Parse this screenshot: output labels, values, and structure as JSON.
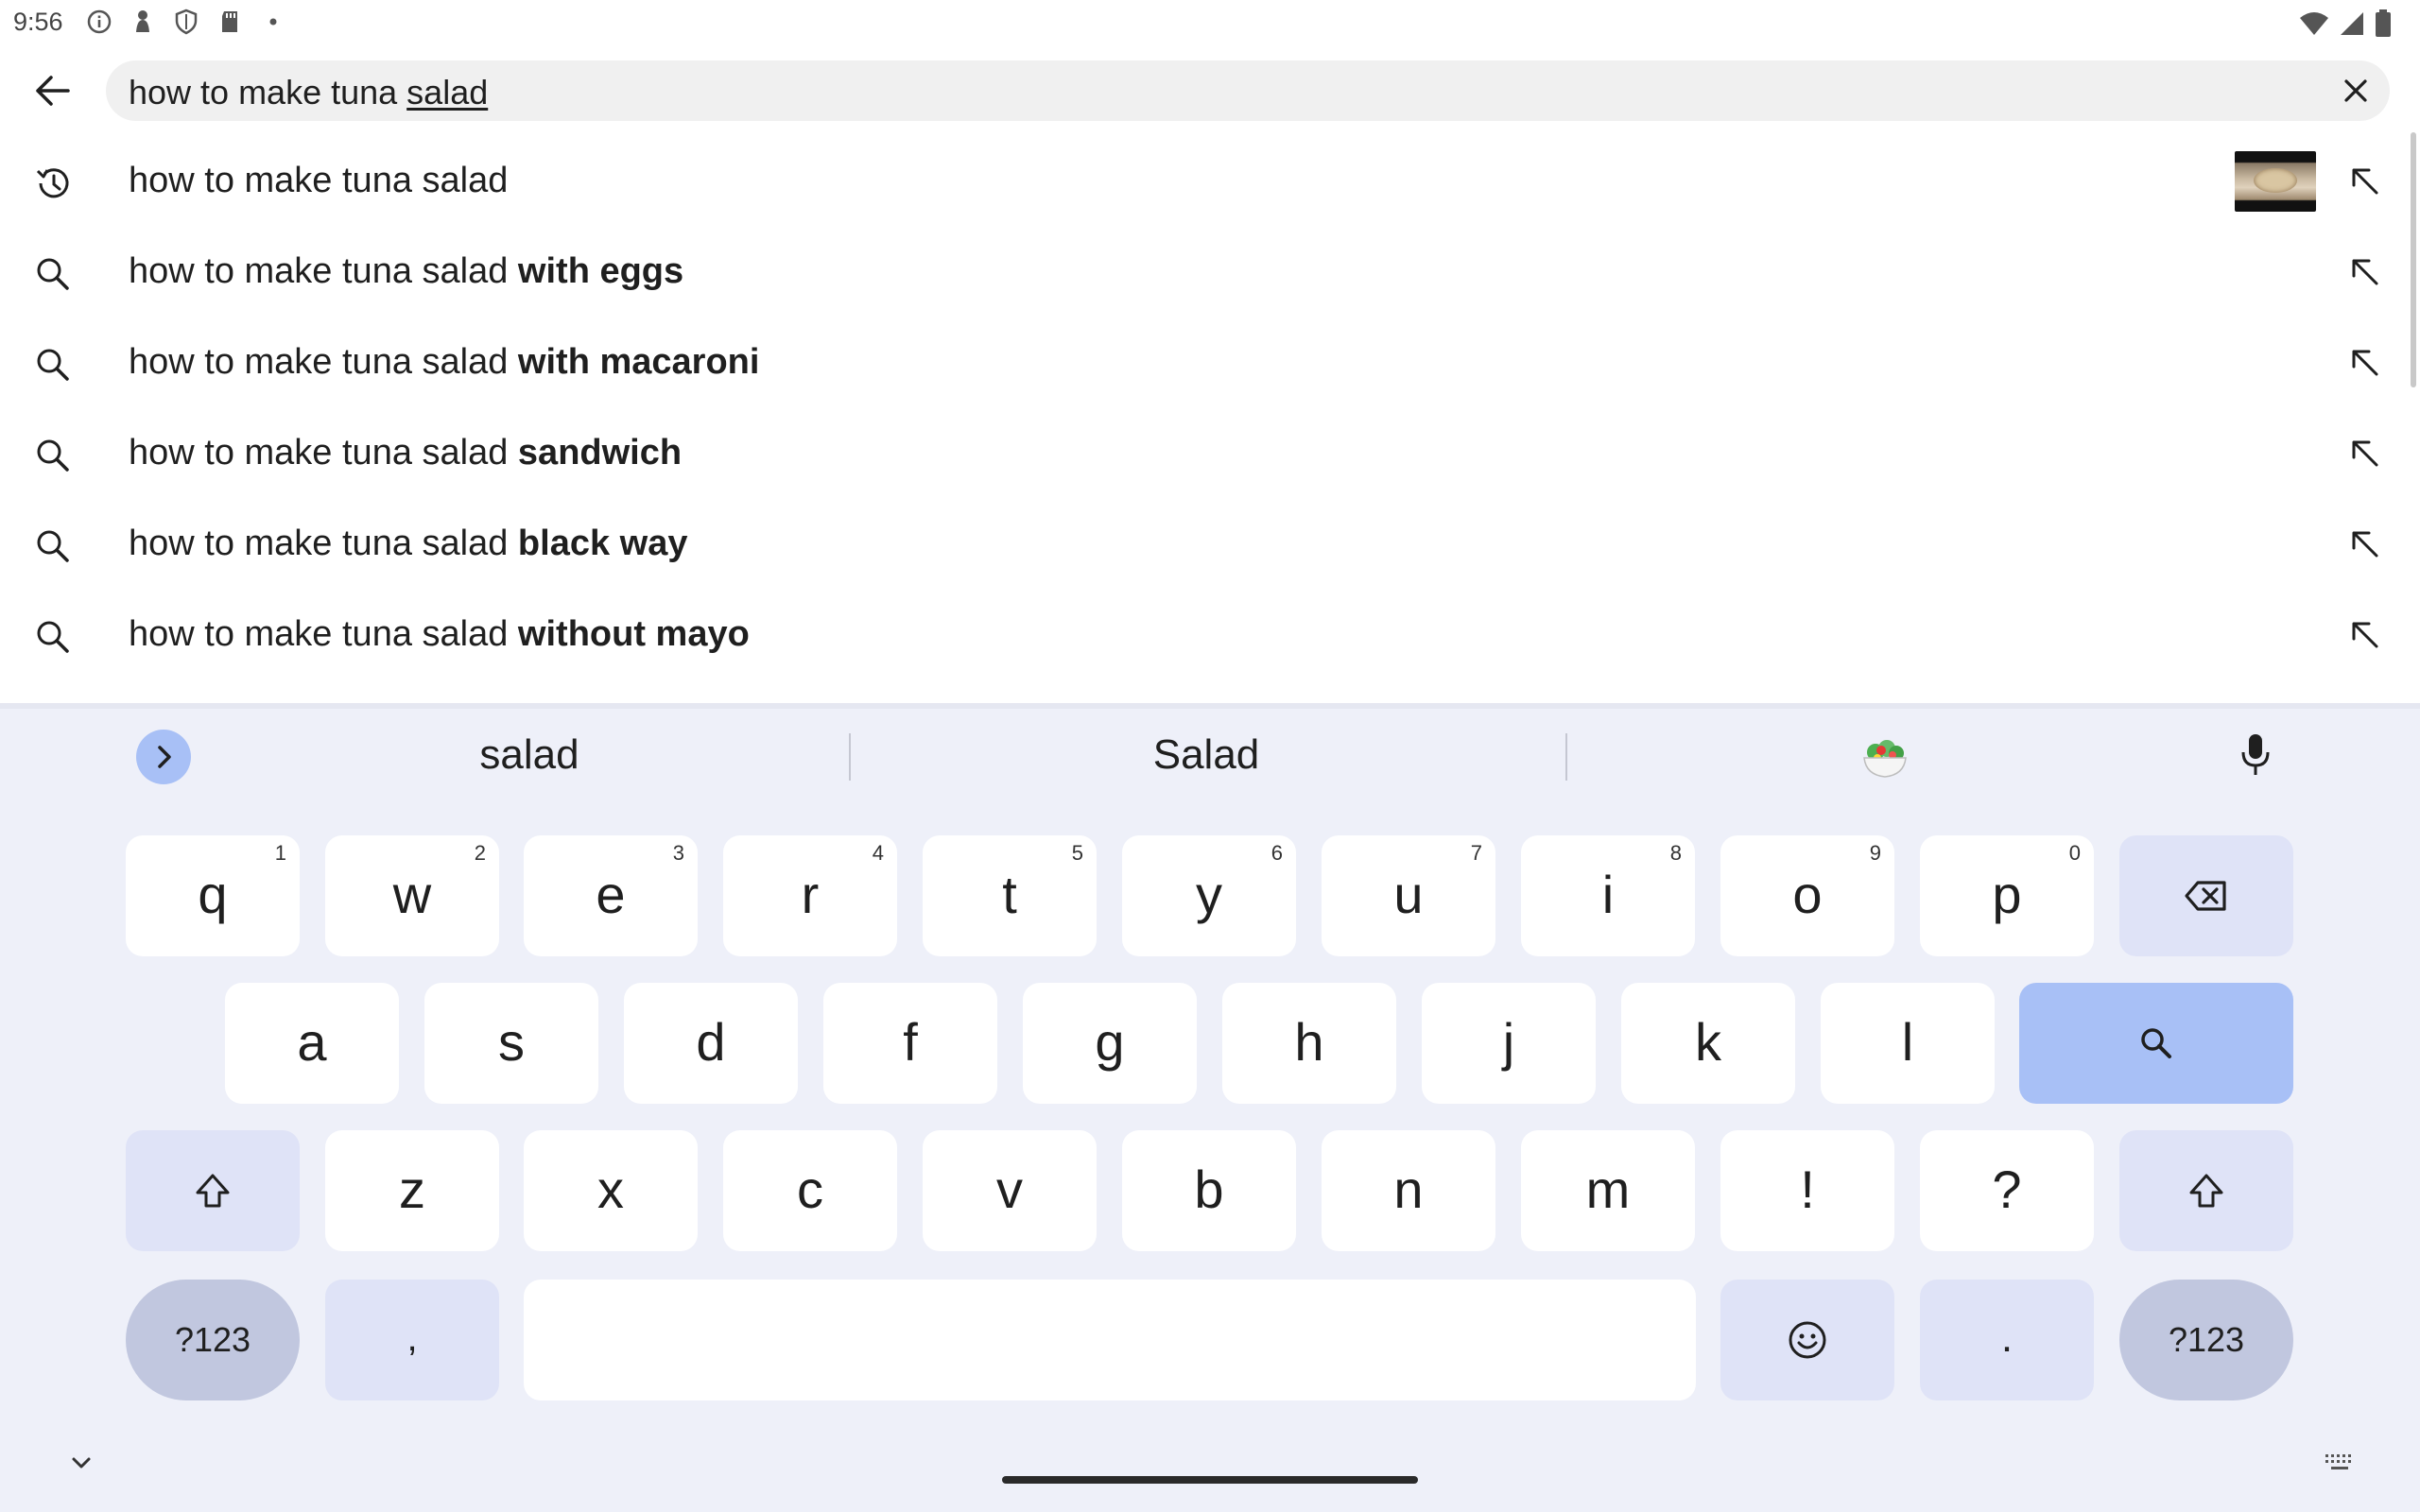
{
  "status_bar": {
    "time": "9:56",
    "left_icons": [
      "info-icon",
      "person-icon",
      "shield-icon",
      "sd-card-icon",
      "dot-icon"
    ],
    "right_icons": [
      "wifi-icon",
      "signal-icon",
      "battery-icon"
    ]
  },
  "search": {
    "query_prefix": "how to make tuna ",
    "query_underlined": "salad",
    "back_icon": "back-arrow-icon",
    "clear_icon": "close-icon"
  },
  "suggestions": [
    {
      "type": "history",
      "prefix": "how to make tuna salad",
      "bold": "",
      "has_thumbnail": true
    },
    {
      "type": "search",
      "prefix": "how to make tuna salad ",
      "bold": "with eggs",
      "has_thumbnail": false
    },
    {
      "type": "search",
      "prefix": "how to make tuna salad ",
      "bold": "with macaroni",
      "has_thumbnail": false
    },
    {
      "type": "search",
      "prefix": "how to make tuna salad ",
      "bold": "sandwich",
      "has_thumbnail": false
    },
    {
      "type": "search",
      "prefix": "how to make tuna salad ",
      "bold": "black way",
      "has_thumbnail": false
    },
    {
      "type": "search",
      "prefix": "how to make tuna salad ",
      "bold": "without mayo",
      "has_thumbnail": false
    }
  ],
  "keyboard": {
    "suggestion_strip": [
      "salad",
      "Salad"
    ],
    "emoji_suggestion": "salad-emoji",
    "row1": [
      {
        "label": "q",
        "hint": "1"
      },
      {
        "label": "w",
        "hint": "2"
      },
      {
        "label": "e",
        "hint": "3"
      },
      {
        "label": "r",
        "hint": "4"
      },
      {
        "label": "t",
        "hint": "5"
      },
      {
        "label": "y",
        "hint": "6"
      },
      {
        "label": "u",
        "hint": "7"
      },
      {
        "label": "i",
        "hint": "8"
      },
      {
        "label": "o",
        "hint": "9"
      },
      {
        "label": "p",
        "hint": "0"
      }
    ],
    "row2": [
      "a",
      "s",
      "d",
      "f",
      "g",
      "h",
      "j",
      "k",
      "l"
    ],
    "row3": [
      "z",
      "x",
      "c",
      "v",
      "b",
      "n",
      "m",
      "!",
      "?"
    ],
    "row4": {
      "symbols_left": "?123",
      "comma": ",",
      "period": ".",
      "symbols_right": "?123"
    }
  },
  "colors": {
    "keyboard_bg": "#eef0f9",
    "mod_key": "#dfe3f7",
    "action_key": "#a8c0f6",
    "symbol_key": "#c1c7df"
  }
}
